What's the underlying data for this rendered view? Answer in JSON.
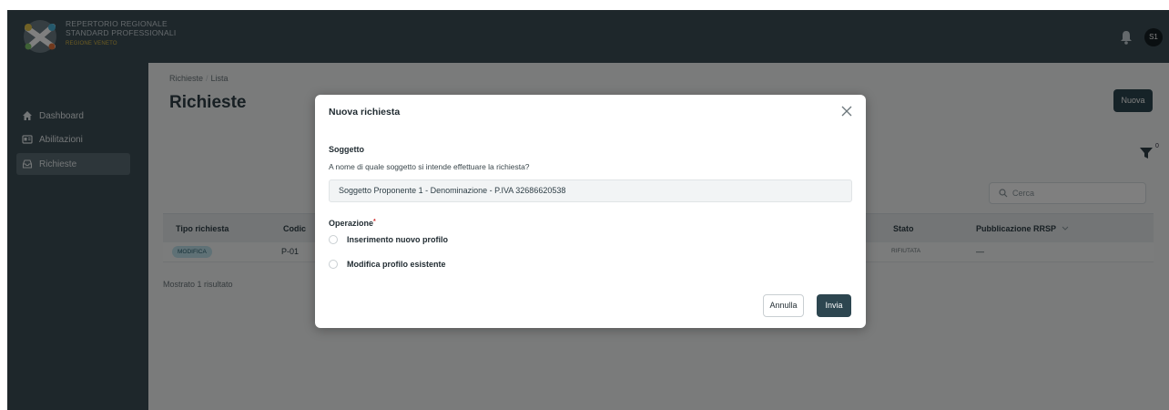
{
  "brand": {
    "line1": "REPERTORIO REGIONALE",
    "line2": "STANDARD PROFESSIONALI",
    "region": "REGIONE VENETO"
  },
  "header": {
    "notifications_icon": "bell-icon",
    "avatar_initials": "S1"
  },
  "sidebar": {
    "items": [
      {
        "label": "Dashboard",
        "icon": "home-icon",
        "active": false
      },
      {
        "label": "Abilitazioni",
        "icon": "id-card-icon",
        "active": false
      },
      {
        "label": "Richieste",
        "icon": "inbox-icon",
        "active": true
      }
    ]
  },
  "page": {
    "breadcrumb": [
      "Richieste",
      "Lista"
    ],
    "title": "Richieste",
    "new_button": "Nuova",
    "filter_count": "0",
    "search_placeholder": "Cerca"
  },
  "table": {
    "headers": [
      "Tipo richiesta",
      "Codic",
      "Stato",
      "Pubblicazione RRSP"
    ],
    "rows": [
      {
        "tipo": "MODIFICA",
        "codice": "P-01",
        "stato": "RIFIUTATA",
        "pubblicazione": "—"
      }
    ],
    "results_text": "Mostrato 1 risultato"
  },
  "modal": {
    "title": "Nuova richiesta",
    "soggetto_label": "Soggetto",
    "soggetto_help": "A nome di quale soggetto si intende effettuare la richiesta?",
    "soggetto_value": "Soggetto Proponente 1 - Denominazione - P.IVA 32686620538",
    "operazione_label": "Operazione",
    "required_mark": "*",
    "options": [
      "Inserimento nuovo profilo",
      "Modifica profilo esistente"
    ],
    "cancel_label": "Annulla",
    "submit_label": "Invia"
  },
  "colors": {
    "primary": "#2d4650",
    "sidebar": "#3d4e56",
    "badge_modifica": "#bfe3ec"
  }
}
